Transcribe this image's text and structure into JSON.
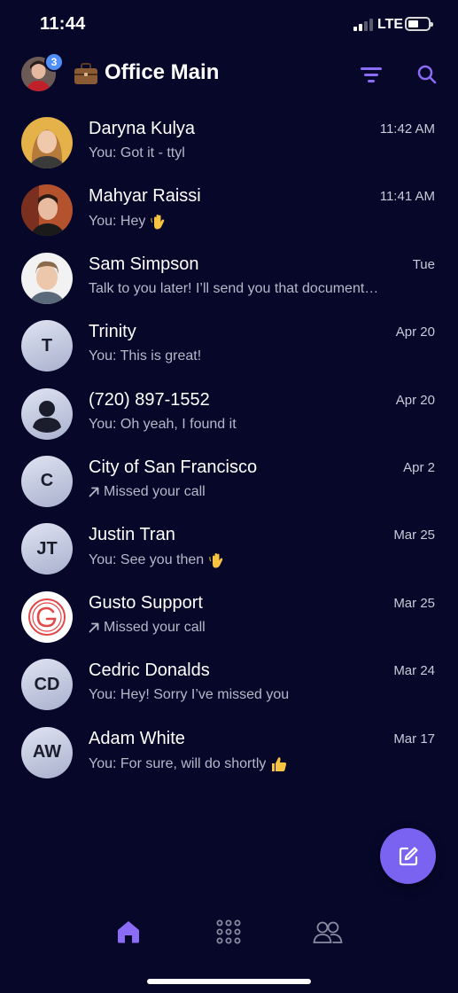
{
  "status_bar": {
    "time": "11:44",
    "network": "LTE",
    "signal_bars": 2,
    "battery_percent": 40
  },
  "header": {
    "badge_count": "3",
    "title": "Office Main",
    "filter_icon": "filter-icon",
    "search_icon": "search-icon",
    "accent_color": "#8b6cf6"
  },
  "conversations": [
    {
      "name": "Daryna Kulya",
      "time": "11:42 AM",
      "preview": "You: Got it - ttyl",
      "avatar": "photo"
    },
    {
      "name": "Mahyar Raissi",
      "time": "11:41 AM",
      "preview": "You: Hey",
      "avatar": "photo",
      "emoji": "waving-hand"
    },
    {
      "name": "Sam Simpson",
      "time": "Tue",
      "preview": "Talk to you later! I’ll send you that document…",
      "avatar": "photo"
    },
    {
      "name": "Trinity",
      "time": "Apr 20",
      "preview": "You: This is great!",
      "avatar": "initials",
      "initials": "T"
    },
    {
      "name": "(720) 897-1552",
      "time": "Apr 20",
      "preview": "You: Oh yeah, I found it",
      "avatar": "placeholder"
    },
    {
      "name": "City of San Francisco",
      "time": "Apr 2",
      "preview": "Missed your call",
      "avatar": "initials",
      "initials": "C",
      "missed_call": true
    },
    {
      "name": "Justin Tran",
      "time": "Mar 25",
      "preview": "You: See you then",
      "avatar": "initials",
      "initials": "JT",
      "emoji": "waving-hand"
    },
    {
      "name": "Gusto Support",
      "time": "Mar 25",
      "preview": "Missed your call",
      "avatar": "logo",
      "missed_call": true
    },
    {
      "name": "Cedric Donalds",
      "time": "Mar 24",
      "preview": "You: Hey! Sorry I’ve missed you",
      "avatar": "initials",
      "initials": "CD"
    },
    {
      "name": "Adam White",
      "time": "Mar 17",
      "preview": "You: For sure, will do shortly",
      "avatar": "initials",
      "initials": "AW",
      "emoji": "thumbs-up"
    }
  ],
  "fab": {
    "icon": "compose-icon",
    "color": "#7a63f0"
  },
  "bottom_nav": {
    "items": [
      {
        "icon": "home-icon",
        "active": true
      },
      {
        "icon": "keypad-icon",
        "active": false
      },
      {
        "icon": "contacts-icon",
        "active": false
      }
    ]
  }
}
